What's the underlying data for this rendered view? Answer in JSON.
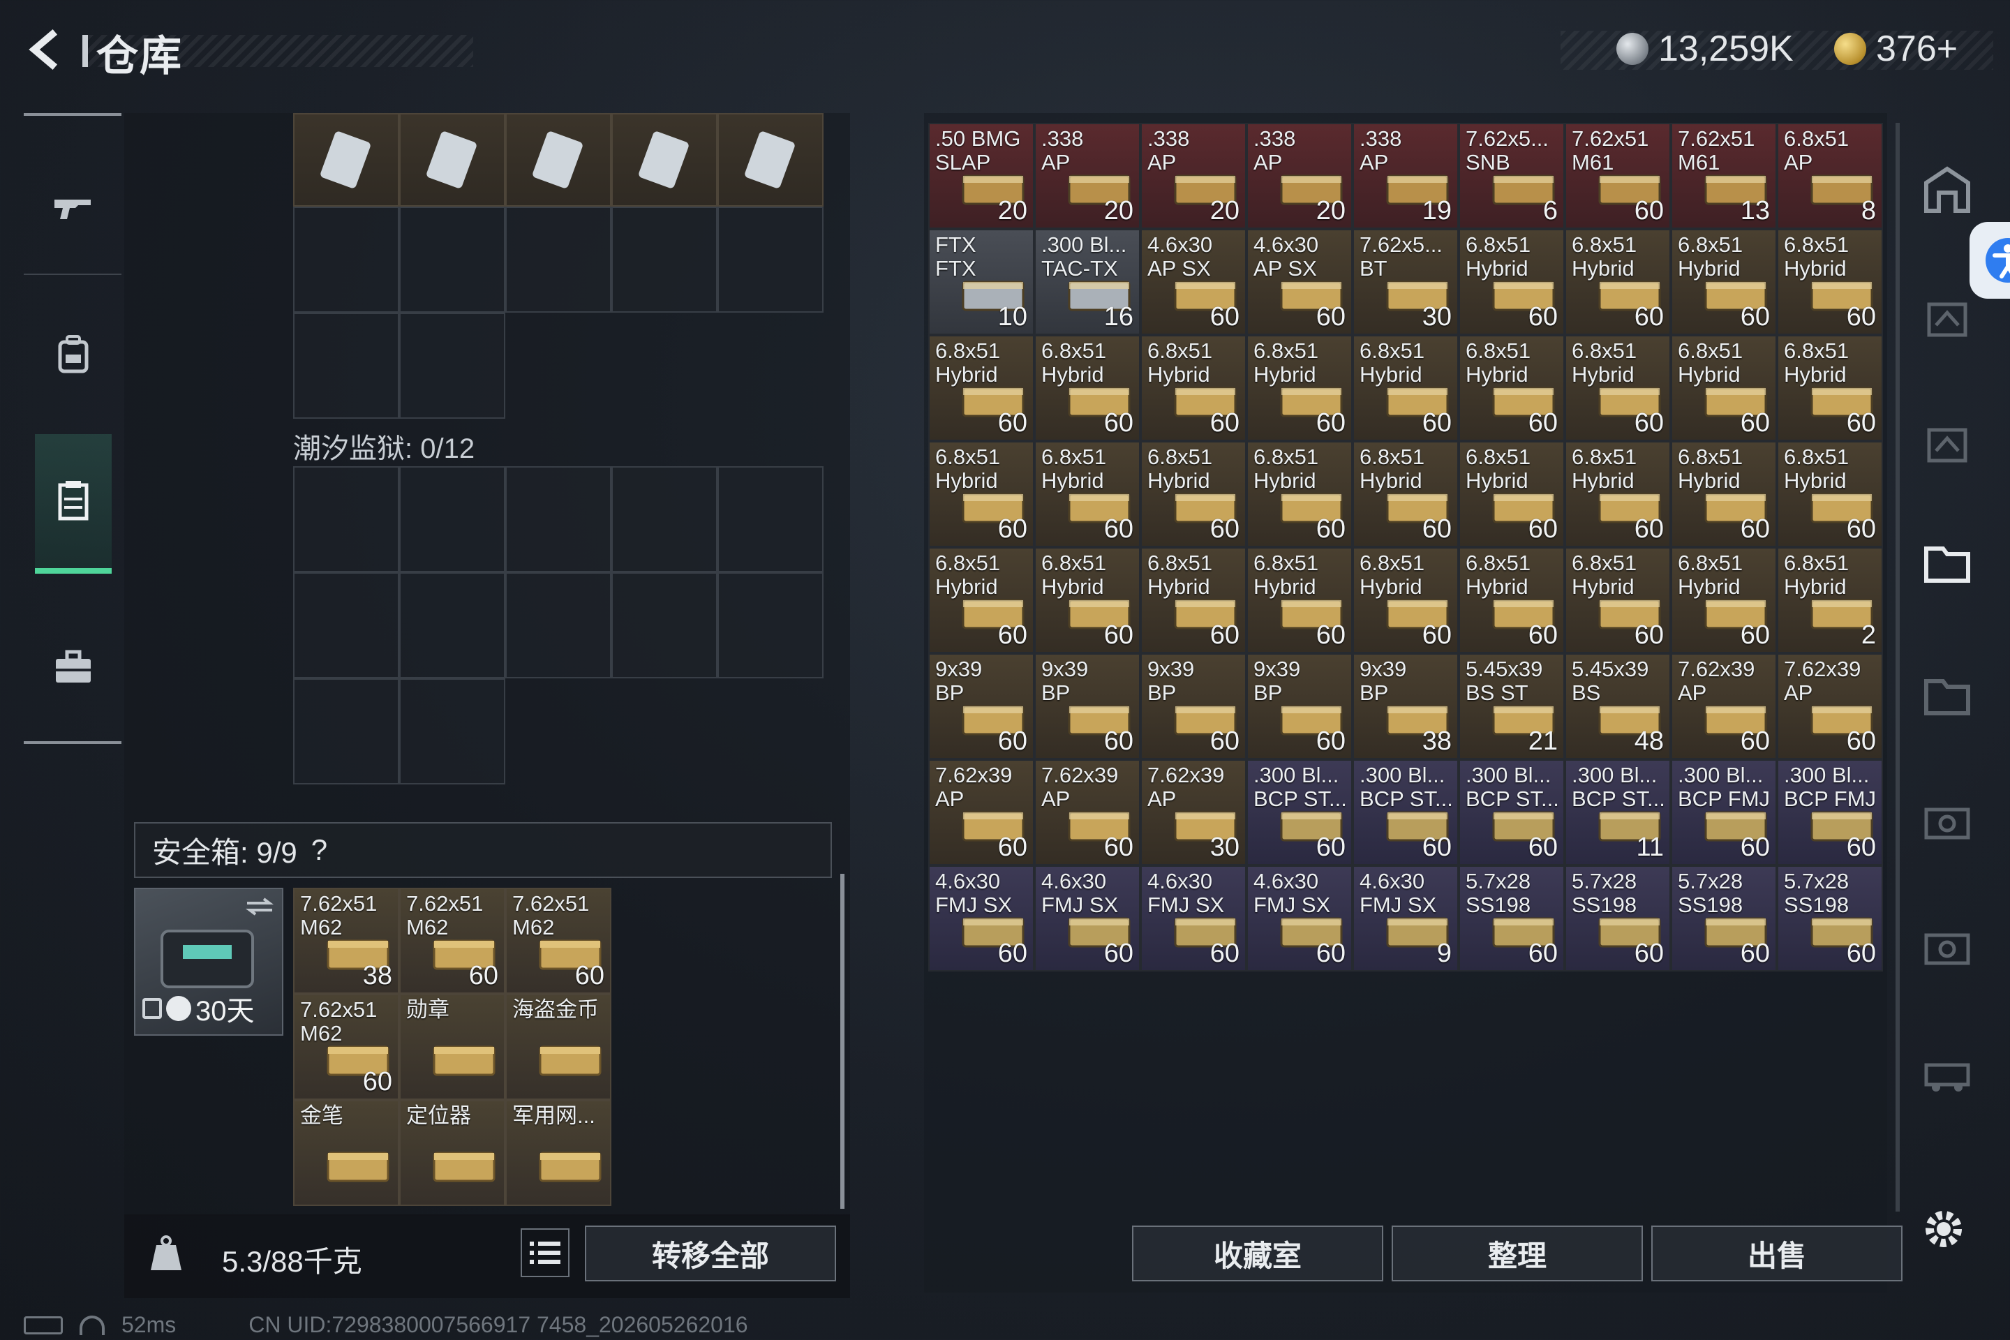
{
  "header": {
    "title": "仓库",
    "currency_1": "13,259K",
    "currency_2": "376+"
  },
  "left_nav": {
    "items": [
      "gun-icon",
      "backpack-icon",
      "storage-icon",
      "briefcase-icon"
    ]
  },
  "left_panel": {
    "section_tidal_prison": "潮汐监狱: 0/12"
  },
  "safe_box": {
    "label": "安全箱: 9/9",
    "help": "?",
    "duration": "30天",
    "items": [
      {
        "name": "7.62x51\nM62",
        "count": "38"
      },
      {
        "name": "7.62x51\nM62",
        "count": "60"
      },
      {
        "name": "7.62x51\nM62",
        "count": "60"
      },
      {
        "name": "7.62x51\nM62",
        "count": "60"
      },
      {
        "name": "勋章",
        "count": ""
      },
      {
        "name": "海盗金币",
        "count": ""
      },
      {
        "name": "金笔",
        "count": ""
      },
      {
        "name": "定位器",
        "count": ""
      },
      {
        "name": "军用网...",
        "count": ""
      }
    ]
  },
  "bottom_left": {
    "weight": "5.3/88千克",
    "transfer_all": "转移全部"
  },
  "storage": {
    "rows": [
      [
        {
          "name": ".50 BMG\nSLAP",
          "count": "20",
          "tint": "red"
        },
        {
          "name": ".338\nAP",
          "count": "20",
          "tint": "red"
        },
        {
          "name": ".338\nAP",
          "count": "20",
          "tint": "red"
        },
        {
          "name": ".338\nAP",
          "count": "20",
          "tint": "red"
        },
        {
          "name": ".338\nAP",
          "count": "19",
          "tint": "red"
        },
        {
          "name": "7.62x5...\nSNB",
          "count": "6",
          "tint": "red"
        },
        {
          "name": "7.62x51\nM61",
          "count": "60",
          "tint": "red"
        },
        {
          "name": "7.62x51\nM61",
          "count": "13",
          "tint": "red"
        },
        {
          "name": "6.8x51\nAP",
          "count": "8",
          "tint": "red"
        }
      ],
      [
        {
          "name": "FTX\nFTX",
          "count": "10",
          "tint": "gray"
        },
        {
          "name": ".300 Bl...\nTAC-TX",
          "count": "16",
          "tint": "gray"
        },
        {
          "name": "4.6x30\nAP SX",
          "count": "60",
          "tint": "brown"
        },
        {
          "name": "4.6x30\nAP SX",
          "count": "60",
          "tint": "brown"
        },
        {
          "name": "7.62x5...\nBT",
          "count": "30",
          "tint": "brown"
        },
        {
          "name": "6.8x51\nHybrid",
          "count": "60",
          "tint": "brown"
        },
        {
          "name": "6.8x51\nHybrid",
          "count": "60",
          "tint": "brown"
        },
        {
          "name": "6.8x51\nHybrid",
          "count": "60",
          "tint": "brown"
        },
        {
          "name": "6.8x51\nHybrid",
          "count": "60",
          "tint": "brown"
        }
      ],
      [
        {
          "name": "6.8x51\nHybrid",
          "count": "60",
          "tint": "brown"
        },
        {
          "name": "6.8x51\nHybrid",
          "count": "60",
          "tint": "brown"
        },
        {
          "name": "6.8x51\nHybrid",
          "count": "60",
          "tint": "brown"
        },
        {
          "name": "6.8x51\nHybrid",
          "count": "60",
          "tint": "brown"
        },
        {
          "name": "6.8x51\nHybrid",
          "count": "60",
          "tint": "brown"
        },
        {
          "name": "6.8x51\nHybrid",
          "count": "60",
          "tint": "brown"
        },
        {
          "name": "6.8x51\nHybrid",
          "count": "60",
          "tint": "brown"
        },
        {
          "name": "6.8x51\nHybrid",
          "count": "60",
          "tint": "brown"
        },
        {
          "name": "6.8x51\nHybrid",
          "count": "60",
          "tint": "brown"
        }
      ],
      [
        {
          "name": "6.8x51\nHybrid",
          "count": "60",
          "tint": "brown"
        },
        {
          "name": "6.8x51\nHybrid",
          "count": "60",
          "tint": "brown"
        },
        {
          "name": "6.8x51\nHybrid",
          "count": "60",
          "tint": "brown"
        },
        {
          "name": "6.8x51\nHybrid",
          "count": "60",
          "tint": "brown"
        },
        {
          "name": "6.8x51\nHybrid",
          "count": "60",
          "tint": "brown"
        },
        {
          "name": "6.8x51\nHybrid",
          "count": "60",
          "tint": "brown"
        },
        {
          "name": "6.8x51\nHybrid",
          "count": "60",
          "tint": "brown"
        },
        {
          "name": "6.8x51\nHybrid",
          "count": "60",
          "tint": "brown"
        },
        {
          "name": "6.8x51\nHybrid",
          "count": "60",
          "tint": "brown"
        }
      ],
      [
        {
          "name": "6.8x51\nHybrid",
          "count": "60",
          "tint": "brown"
        },
        {
          "name": "6.8x51\nHybrid",
          "count": "60",
          "tint": "brown"
        },
        {
          "name": "6.8x51\nHybrid",
          "count": "60",
          "tint": "brown"
        },
        {
          "name": "6.8x51\nHybrid",
          "count": "60",
          "tint": "brown"
        },
        {
          "name": "6.8x51\nHybrid",
          "count": "60",
          "tint": "brown"
        },
        {
          "name": "6.8x51\nHybrid",
          "count": "60",
          "tint": "brown"
        },
        {
          "name": "6.8x51\nHybrid",
          "count": "60",
          "tint": "brown"
        },
        {
          "name": "6.8x51\nHybrid",
          "count": "60",
          "tint": "brown"
        },
        {
          "name": "6.8x51\nHybrid",
          "count": "2",
          "tint": "brown"
        }
      ],
      [
        {
          "name": "9x39\nBP",
          "count": "60",
          "tint": "brown"
        },
        {
          "name": "9x39\nBP",
          "count": "60",
          "tint": "brown"
        },
        {
          "name": "9x39\nBP",
          "count": "60",
          "tint": "brown"
        },
        {
          "name": "9x39\nBP",
          "count": "60",
          "tint": "brown"
        },
        {
          "name": "9x39\nBP",
          "count": "38",
          "tint": "brown"
        },
        {
          "name": "5.45x39\nBS ST",
          "count": "21",
          "tint": "brown"
        },
        {
          "name": "5.45x39\nBS",
          "count": "48",
          "tint": "brown"
        },
        {
          "name": "7.62x39\nAP",
          "count": "60",
          "tint": "brown"
        },
        {
          "name": "7.62x39\nAP",
          "count": "60",
          "tint": "brown"
        }
      ],
      [
        {
          "name": "7.62x39\nAP",
          "count": "60",
          "tint": "brown"
        },
        {
          "name": "7.62x39\nAP",
          "count": "60",
          "tint": "brown"
        },
        {
          "name": "7.62x39\nAP",
          "count": "30",
          "tint": "brown"
        },
        {
          "name": ".300 Bl...\nBCP ST...",
          "count": "60",
          "tint": "purple"
        },
        {
          "name": ".300 Bl...\nBCP ST...",
          "count": "60",
          "tint": "purple"
        },
        {
          "name": ".300 Bl...\nBCP ST...",
          "count": "60",
          "tint": "purple"
        },
        {
          "name": ".300 Bl...\nBCP ST...",
          "count": "11",
          "tint": "purple"
        },
        {
          "name": ".300 Bl...\nBCP FMJ",
          "count": "60",
          "tint": "purple"
        },
        {
          "name": ".300 Bl...\nBCP FMJ",
          "count": "60",
          "tint": "purple"
        }
      ],
      [
        {
          "name": "4.6x30\nFMJ SX",
          "count": "60",
          "tint": "purple"
        },
        {
          "name": "4.6x30\nFMJ SX",
          "count": "60",
          "tint": "purple"
        },
        {
          "name": "4.6x30\nFMJ SX",
          "count": "60",
          "tint": "purple"
        },
        {
          "name": "4.6x30\nFMJ SX",
          "count": "60",
          "tint": "purple"
        },
        {
          "name": "4.6x30\nFMJ SX",
          "count": "9",
          "tint": "purple"
        },
        {
          "name": "5.7x28\nSS198",
          "count": "60",
          "tint": "purple"
        },
        {
          "name": "5.7x28\nSS198",
          "count": "60",
          "tint": "purple"
        },
        {
          "name": "5.7x28\nSS198",
          "count": "60",
          "tint": "purple"
        },
        {
          "name": "5.7x28\nSS198",
          "count": "60",
          "tint": "purple"
        }
      ]
    ]
  },
  "bottom_right": {
    "collection": "收藏室",
    "sort": "整理",
    "sell": "出售"
  },
  "status": {
    "ping": "52ms",
    "uid": "CN UID:7298380007566917 7458_202605262016"
  }
}
